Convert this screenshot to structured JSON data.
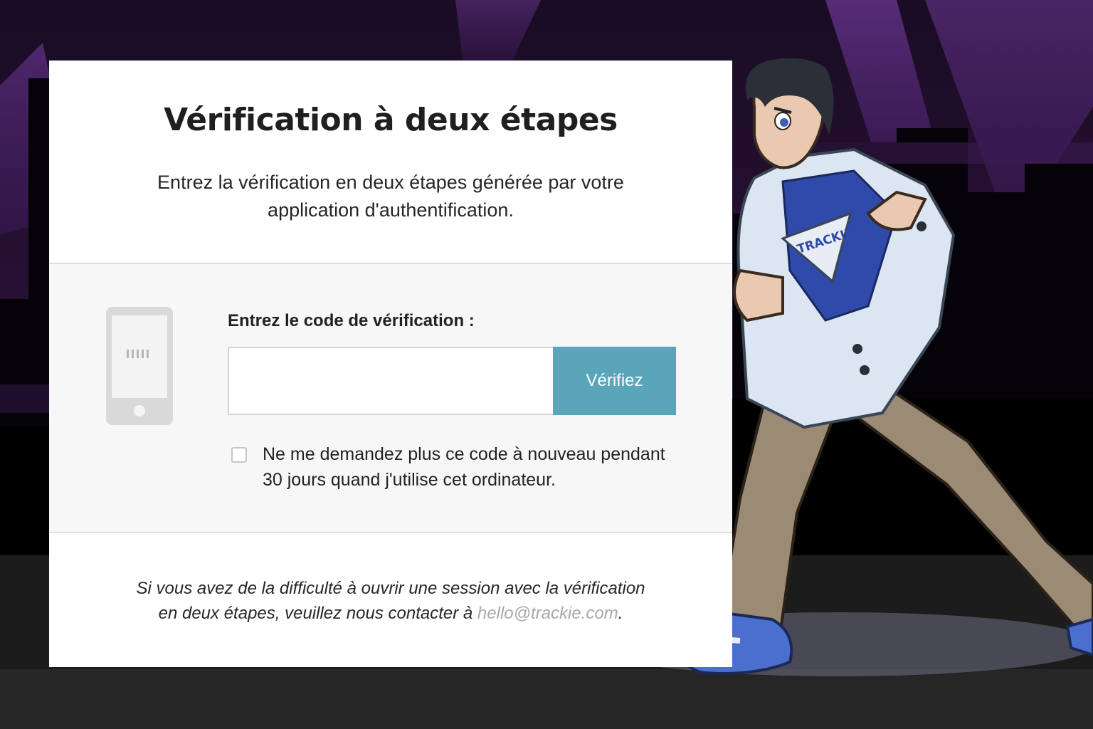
{
  "page": {
    "title": "Vérification à deux étapes",
    "subtitle": "Entrez la vérification en deux étapes générée par votre application d'authentification."
  },
  "form": {
    "code_label": "Entrez le code de vérification :",
    "code_value": "",
    "verify_button": "Vérifiez",
    "remember_checked": false,
    "remember_label_line1": "Ne me demandez plus ce code à nouveau pendant",
    "remember_label_line2": "30 jours quand j'utilise cet ordinateur."
  },
  "footer": {
    "help_text_line1": "Si vous avez de la difficulté à ouvrir une session avec la vérification",
    "help_text_line2": "en deux étapes, veuillez nous contacter à",
    "help_email": "hello@trackie.com",
    "help_suffix": "."
  },
  "mascot": {
    "shirt_logo": "TRACKIE"
  },
  "icons": {
    "phone": "smartphone-icon",
    "checkbox": "checkbox-icon"
  },
  "colors": {
    "verify_button": "#5aa5b9",
    "link": "#a8a8a8",
    "body_bg": "#f7f7f7",
    "background_purple": "#5b2a7e"
  }
}
